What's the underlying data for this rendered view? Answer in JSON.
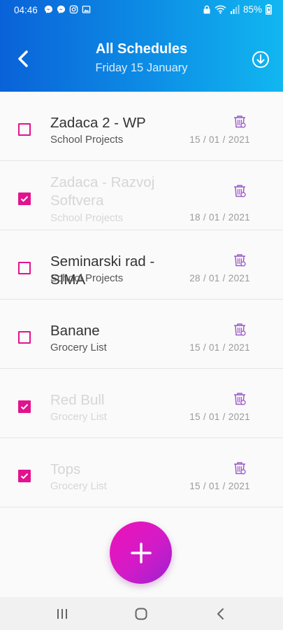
{
  "status_bar": {
    "time": "04:46",
    "battery": "85%",
    "icons_left": [
      "messenger-icon",
      "messenger-icon",
      "instagram-icon",
      "gallery-icon"
    ],
    "icons_right": [
      "lock-icon",
      "wifi-icon",
      "signal-icon",
      "battery-icon"
    ]
  },
  "header": {
    "title": "All Schedules",
    "subtitle": "Friday 15 January",
    "gradient_start": "#0a62d8",
    "gradient_end": "#11b7f0"
  },
  "tasks": [
    {
      "title": "Zadaca 2 - WP",
      "category": "School Projects",
      "date": "15 / 01 / 2021",
      "done": false
    },
    {
      "title": "Zadaca - Razvoj Softvera",
      "category": "School Projects",
      "date": "18 / 01 / 2021",
      "done": true
    },
    {
      "title": "Seminarski rad - SIMA",
      "category": "School Projects",
      "date": "28 / 01 / 2021",
      "done": false
    },
    {
      "title": "Banane",
      "category": "Grocery List",
      "date": "15 / 01 / 2021",
      "done": false
    },
    {
      "title": "Red Bull",
      "category": "Grocery List",
      "date": "15 / 01 / 2021",
      "done": true
    },
    {
      "title": "Tops",
      "category": "Grocery List",
      "date": "15 / 01 / 2021",
      "done": true
    }
  ],
  "fab": {
    "icon": "plus-icon"
  },
  "colors": {
    "accent": "#e2138e",
    "fab_start": "#ee12b8",
    "fab_end": "#9c21d0",
    "trash_icon": "#9b59c9"
  },
  "navbar": {
    "buttons": [
      "recent-apps-icon",
      "home-icon",
      "back-icon"
    ]
  }
}
